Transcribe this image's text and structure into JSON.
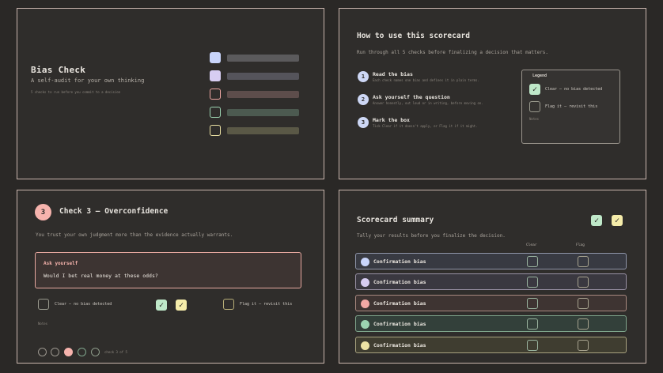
{
  "slide1": {
    "title": "Bias Check",
    "subtitle": "A self-audit for your own thinking",
    "note": "5 checks to run before you commit to a decision",
    "swatches": [
      "#c9d5fb",
      "#d7cdf2",
      "#f2a9a5",
      "#9cd4b1",
      "#ece2a4"
    ],
    "bars": [
      "#5b5a5c",
      "#55545b",
      "#5d4d4b",
      "#4c5a50",
      "#5a5846"
    ]
  },
  "slide2": {
    "title": "How to use this scorecard",
    "subtitle": "Run through all 5 checks before finalizing a decision that matters.",
    "steps": [
      {
        "num": "1",
        "title": "Read the bias",
        "desc": "Each check names one bias and defines it in plain terms."
      },
      {
        "num": "2",
        "title": "Ask yourself the question",
        "desc": "Answer honestly, out loud or in writing, before moving on."
      },
      {
        "num": "3",
        "title": "Mark the box",
        "desc": "Tick Clear if it doesn't apply, or Flag it if it might."
      }
    ],
    "legend": {
      "title": "Legend",
      "clear": "Clear — no bias detected",
      "flag": "Flag it — revisit this",
      "notes": "Notes"
    }
  },
  "slide3": {
    "num": "3",
    "title": "Check 3 — Overconfidence",
    "desc": "You trust your own judgment more than the evidence actually warrants.",
    "ask_label": "Ask yourself",
    "question": "Would I bet real money at these odds?",
    "clear": "Clear — no bias detected",
    "flag": "Flag it — revisit this",
    "notes": "Notes",
    "page": "check 3 of 5",
    "check_mark": "✓"
  },
  "slide4": {
    "title": "Scorecard summary",
    "subtitle": "Tally your results before you finalize the decision.",
    "col_clear": "Clear",
    "col_flag": "Flag",
    "rows": [
      {
        "label": "Confirmation bias",
        "dot": "#c9d5fb",
        "bg": "#383a42",
        "border": "#8e94a8"
      },
      {
        "label": "Confirmation bias",
        "dot": "#d7cdf2",
        "bg": "#3a3840",
        "border": "#9890a4"
      },
      {
        "label": "Confirmation bias",
        "dot": "#f2a9a5",
        "bg": "#3e3432",
        "border": "#a8887f"
      },
      {
        "label": "Confirmation bias",
        "dot": "#9cd4b1",
        "bg": "#33403a",
        "border": "#7fa58c"
      },
      {
        "label": "Confirmation bias",
        "dot": "#ece2a4",
        "bg": "#3f3d30",
        "border": "#a8a27f"
      }
    ]
  },
  "colors": {
    "accent_green": "#bfe8c9",
    "accent_yellow": "#f5ecaa",
    "accent_pink": "#f6b3ad",
    "step_blue": "#cdd7f5"
  }
}
